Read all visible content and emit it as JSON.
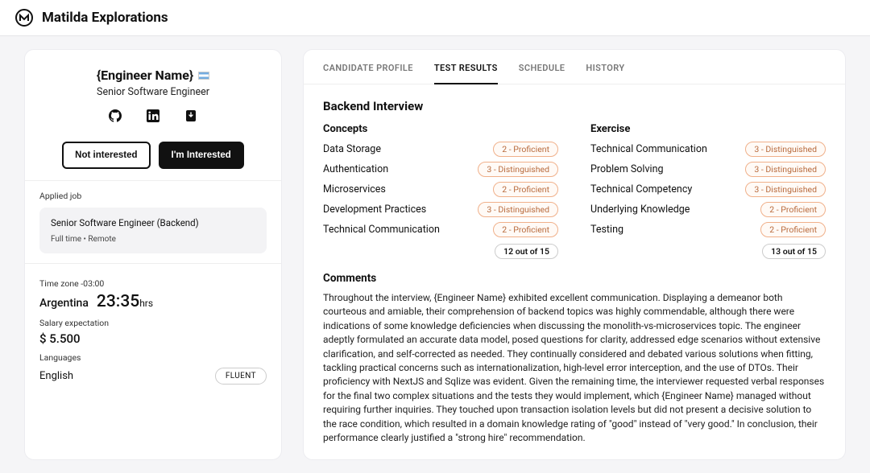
{
  "header": {
    "title": "Matilda Explorations"
  },
  "candidate": {
    "name": "{Engineer Name}",
    "role": "Senior Software Engineer",
    "notInterested": "Not interested",
    "interested": "I'm Interested"
  },
  "applied": {
    "label": "Applied job",
    "title": "Senior Software Engineer (Backend)",
    "sub": "Full time • Remote"
  },
  "meta": {
    "tzLabel": "Time zone -03:00",
    "country": "Argentina",
    "time": "23:35",
    "hrs": "hrs",
    "salaryLabel": "Salary expectation",
    "salary": "$ 5.500",
    "langLabel": "Languages",
    "langName": "English",
    "langLevel": "FLUENT"
  },
  "tabs": {
    "profile": "CANDIDATE PROFILE",
    "results": "TEST RESULTS",
    "schedule": "SCHEDULE",
    "history": "HISTORY"
  },
  "interview": {
    "title": "Backend Interview",
    "conceptsHead": "Concepts",
    "exerciseHead": "Exercise",
    "concepts": [
      {
        "label": "Data Storage",
        "badge": "2 - Proficient"
      },
      {
        "label": "Authentication",
        "badge": "3 - Distinguished"
      },
      {
        "label": "Microservices",
        "badge": "2 - Proficient"
      },
      {
        "label": "Development Practices",
        "badge": "3 - Distinguished"
      },
      {
        "label": "Technical Communication",
        "badge": "2 - Proficient"
      }
    ],
    "conceptsScore": "12 out of 15",
    "exercise": [
      {
        "label": "Technical Communication",
        "badge": "3 - Distinguished"
      },
      {
        "label": "Problem Solving",
        "badge": "3 - Distinguished"
      },
      {
        "label": "Technical Competency",
        "badge": "3 - Distinguished"
      },
      {
        "label": "Underlying Knowledge",
        "badge": "2 - Proficient"
      },
      {
        "label": "Testing",
        "badge": "2 - Proficient"
      }
    ],
    "exerciseScore": "13 out of 15",
    "commentsHead": "Comments",
    "comments": "Throughout the interview, {Engineer Name} exhibited excellent communication. Displaying a demeanor both courteous and amiable, their comprehension of backend topics was highly commendable, although there were indications of some knowledge deficiencies when discussing the monolith-vs-microservices topic. The engineer adeptly formulated an accurate data model, posed questions for clarity, addressed edge scenarios without extensive clarification, and self-corrected as needed. They continually considered and debated various solutions when fitting, tackling practical concerns such as internationalization, high-level error interception, and the use of DTOs. Their proficiency with NextJS and Sqlize was evident. Given the remaining time, the interviewer requested verbal responses for the final two complex situations and the tests they would implement, which {Engineer Name} managed without requiring further inquiries. They touched upon transaction isolation levels but did not present a decisive solution to the race condition, which resulted in a domain knowledge rating of \"good\" instead of \"very good.\" In conclusion, their performance clearly justified a \"strong hire\" recommendation."
  }
}
